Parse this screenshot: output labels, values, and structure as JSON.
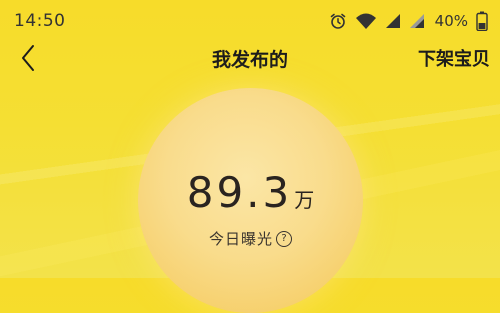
{
  "status_bar": {
    "time": "14:50",
    "battery": "40%",
    "icons": [
      "alarm-icon",
      "wifi-icon",
      "signal-icon",
      "signal-icon"
    ]
  },
  "nav": {
    "title": "我发布的",
    "right_action": "下架宝贝",
    "back_icon": "chevron-left-icon"
  },
  "exposure": {
    "value": "89.3",
    "unit": "万",
    "label": "今日曝光",
    "help_symbol": "?"
  },
  "colors": {
    "background": "#f7dc2a",
    "circle": "#f9dc8c",
    "text_dark": "#1c1c1c"
  }
}
